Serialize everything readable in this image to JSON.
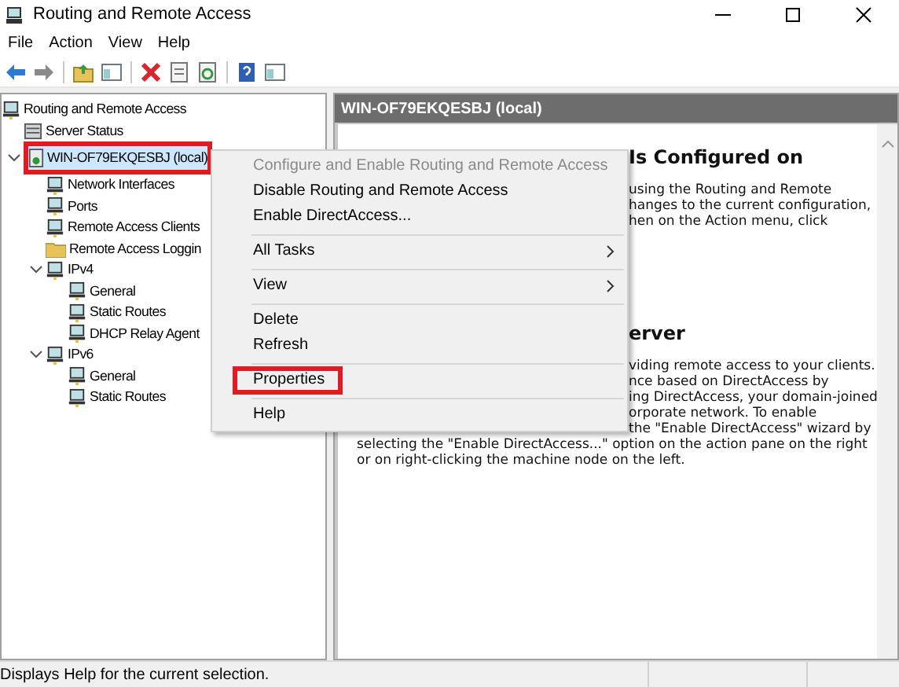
{
  "window": {
    "title": "Routing and Remote Access"
  },
  "menu_bar": [
    "File",
    "Action",
    "View",
    "Help"
  ],
  "toolbar": [
    {
      "kind": "back"
    },
    {
      "kind": "forward"
    },
    {
      "kind": "sep"
    },
    {
      "kind": "up"
    },
    {
      "kind": "pane"
    },
    {
      "kind": "sep"
    },
    {
      "kind": "delete"
    },
    {
      "kind": "props"
    },
    {
      "kind": "refresh"
    },
    {
      "kind": "sep"
    },
    {
      "kind": "help"
    },
    {
      "kind": "pane"
    }
  ],
  "tree": [
    {
      "label": "Routing and Remote Access",
      "kind": "server",
      "selected": false,
      "highlighted": false,
      "children": [
        {
          "label": "Server Status",
          "kind": "status",
          "selected": false,
          "highlighted": false
        },
        {
          "label": "WIN-OF79EKQESBJ (local)",
          "kind": "machine",
          "selected": true,
          "highlighted": true,
          "expanded": true,
          "children": [
            {
              "label": "Network Interfaces",
              "kind": "server",
              "selected": false,
              "highlighted": false
            },
            {
              "label": "Ports",
              "kind": "server",
              "selected": false,
              "highlighted": false
            },
            {
              "label": "Remote Access Clients",
              "kind": "server",
              "selected": false,
              "highlighted": false
            },
            {
              "label": "Remote Access Loggin",
              "kind": "folder",
              "selected": false,
              "highlighted": false
            },
            {
              "label": "IPv4",
              "kind": "server",
              "selected": false,
              "highlighted": false,
              "expanded": true,
              "children": [
                {
                  "label": "General",
                  "kind": "server",
                  "selected": false,
                  "highlighted": false
                },
                {
                  "label": "Static Routes",
                  "kind": "server",
                  "selected": false,
                  "highlighted": false
                },
                {
                  "label": "DHCP Relay Agent",
                  "kind": "server",
                  "selected": false,
                  "highlighted": false
                }
              ]
            },
            {
              "label": "IPv6",
              "kind": "server",
              "selected": false,
              "highlighted": false,
              "expanded": true,
              "children": [
                {
                  "label": "General",
                  "kind": "server",
                  "selected": false,
                  "highlighted": false
                },
                {
                  "label": "Static Routes",
                  "kind": "server",
                  "selected": false,
                  "highlighted": false
                }
              ]
            }
          ]
        }
      ]
    }
  ],
  "details": {
    "header": "WIN-OF79EKQESBJ (local)",
    "blocks": [
      {
        "kind": "cut_heading",
        "text": "Is Configured on"
      },
      {
        "kind": "cut_line",
        "text": "using the Routing and Remote"
      },
      {
        "kind": "cut_line",
        "text": "hanges to the current configuration,"
      },
      {
        "kind": "cut_line",
        "text": "hen on the Action menu, click"
      },
      {
        "kind": "gap"
      },
      {
        "kind": "cut_heading",
        "text": "erver"
      },
      {
        "kind": "cut_line",
        "text": "viding remote access to your clients."
      },
      {
        "kind": "cut_line",
        "text": "nce based on DirectAccess by"
      },
      {
        "kind": "cut_line",
        "text": "ing DirectAccess, your domain-joined"
      },
      {
        "kind": "cut_line",
        "text": "orporate network. To enable"
      },
      {
        "kind": "cut_line",
        "text": "the \"Enable DirectAccess\" wizard by"
      },
      {
        "kind": "line",
        "text": "selecting the \"Enable DirectAccess...\" option on the action pane on the right"
      },
      {
        "kind": "line",
        "text": "or on right-clicking the machine node on the left."
      }
    ]
  },
  "context_menu": [
    {
      "kind": "item",
      "label": "Configure and Enable Routing and Remote Access",
      "disabled": true,
      "submenu": false,
      "highlighted": false
    },
    {
      "kind": "item",
      "label": "Disable Routing and Remote Access",
      "disabled": false,
      "submenu": false,
      "highlighted": false
    },
    {
      "kind": "item",
      "label": "Enable DirectAccess...",
      "disabled": false,
      "submenu": false,
      "highlighted": false
    },
    {
      "kind": "separator"
    },
    {
      "kind": "item",
      "label": "All Tasks",
      "disabled": false,
      "submenu": true,
      "highlighted": false
    },
    {
      "kind": "separator"
    },
    {
      "kind": "item",
      "label": "View",
      "disabled": false,
      "submenu": true,
      "highlighted": false
    },
    {
      "kind": "separator"
    },
    {
      "kind": "item",
      "label": "Delete",
      "disabled": false,
      "submenu": false,
      "highlighted": false
    },
    {
      "kind": "item",
      "label": "Refresh",
      "disabled": false,
      "submenu": false,
      "highlighted": false
    },
    {
      "kind": "separator"
    },
    {
      "kind": "item",
      "label": "Properties",
      "disabled": false,
      "submenu": false,
      "highlighted": true
    },
    {
      "kind": "separator"
    },
    {
      "kind": "item",
      "label": "Help",
      "disabled": false,
      "submenu": false,
      "highlighted": false
    }
  ],
  "status_bar": {
    "text": "Displays Help for the current selection."
  }
}
